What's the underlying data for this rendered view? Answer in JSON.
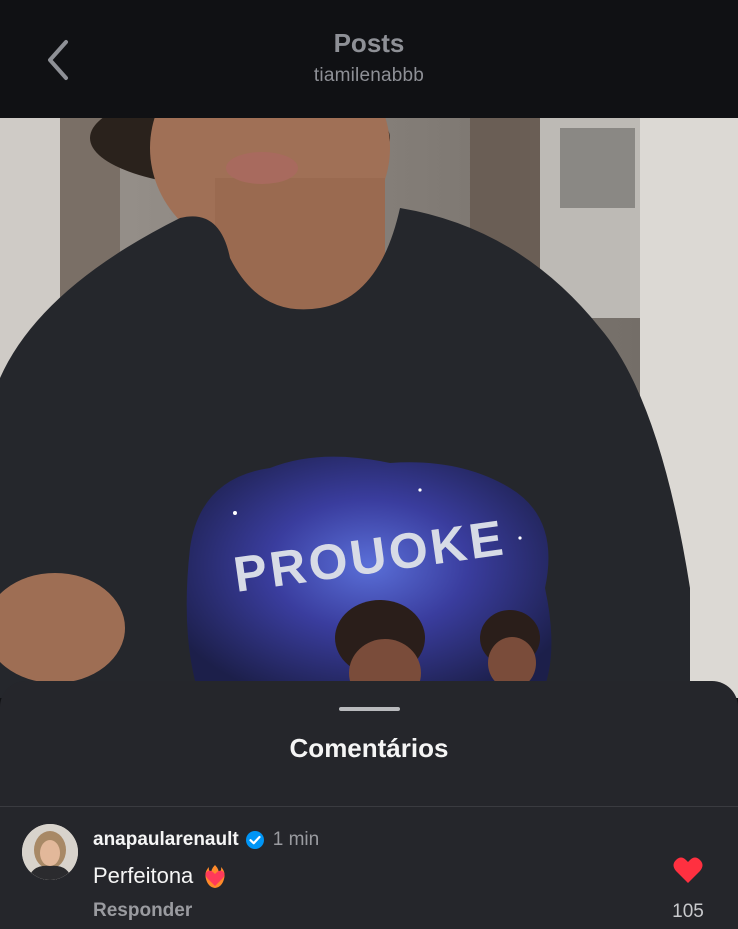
{
  "header": {
    "title": "Posts",
    "username": "tiamilenabbb",
    "back_icon": "chevron-left-icon"
  },
  "media": {
    "shirt_text": "PROUOKE"
  },
  "comments_sheet": {
    "title": "Comentários",
    "comments": [
      {
        "username": "anapaularenault",
        "verified": true,
        "time": "1 min",
        "text": "Perfeitona",
        "emoji": "heart-on-fire-icon",
        "reply_label": "Responder",
        "like_count": "105",
        "liked": true
      }
    ]
  },
  "colors": {
    "background": "#101114",
    "sheet": "#25262b",
    "like_red": "#ff3040",
    "verified_blue": "#0095f6"
  }
}
